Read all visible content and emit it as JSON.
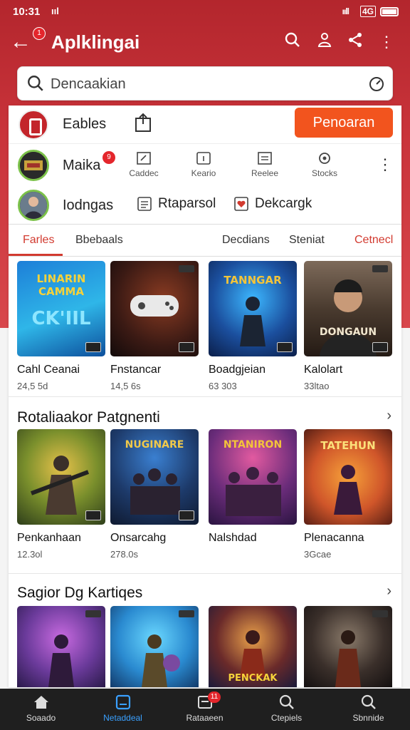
{
  "status_bar": {
    "time": "10:31",
    "left_signal": "ııl",
    "right_signal": "ııll",
    "network": "4G"
  },
  "app_bar": {
    "title": "Aplklingai",
    "back_badge": "1"
  },
  "search": {
    "placeholder": "Dencaakian"
  },
  "top_row": {
    "label": "Eables",
    "button": "Penoaran"
  },
  "profiles": [
    {
      "name": "Maika",
      "badge": "9",
      "actions": [
        "Caddec",
        "Keario",
        "Reelee",
        "Stocks"
      ]
    },
    {
      "name": "Iodngas",
      "chips": [
        "Rtaparsol",
        "Dekcargk"
      ]
    }
  ],
  "tabs": [
    "Farles",
    "Bbebaals",
    "Decdians",
    "Steniat",
    "Cetnecl"
  ],
  "sections": [
    {
      "title": "",
      "tiles": [
        {
          "name": "Cahl Ceanai",
          "meta": "24,5 5d",
          "art_text": "LINARIN\nCAMMA",
          "art_text2": "CK'IIL"
        },
        {
          "name": "Fnstancar",
          "meta": "14,5 6s",
          "art_text": "",
          "art_text2": ""
        },
        {
          "name": "Boadgjeian",
          "meta": "63 303",
          "art_text": "TANNGAR",
          "art_text2": ""
        },
        {
          "name": "Kalolart",
          "meta": "33ltao",
          "art_text": "",
          "art_text2": "DONGAUN"
        }
      ]
    },
    {
      "title": "Rotaliaakor Patgnenti",
      "tiles": [
        {
          "name": "Penkanhaan",
          "meta": "12.3ol",
          "art_text": "",
          "art_text2": ""
        },
        {
          "name": "Onsarcahg",
          "meta": "278.0s",
          "art_text": "NUGINARE",
          "art_text2": ""
        },
        {
          "name": "Nalshdad",
          "meta": "",
          "art_text": "NTANIRON",
          "art_text2": ""
        },
        {
          "name": "Plenacanna",
          "meta": "3Gcae",
          "art_text": "TATEHUN",
          "art_text2": ""
        }
      ]
    },
    {
      "title": "Sagior Dg Kartiqes",
      "tiles": [
        {
          "name": "",
          "meta": "",
          "art_text": "",
          "art_text2": ""
        },
        {
          "name": "",
          "meta": "",
          "art_text": "",
          "art_text2": ""
        },
        {
          "name": "",
          "meta": "",
          "art_text": "",
          "art_text2": "PENCKAK"
        },
        {
          "name": "",
          "meta": "",
          "art_text": "",
          "art_text2": ""
        }
      ]
    }
  ],
  "bottom_nav": [
    {
      "label": "Soaado"
    },
    {
      "label": "Netaddeal"
    },
    {
      "label": "Rataaeen",
      "badge": "11"
    },
    {
      "label": "Ctepiels"
    },
    {
      "label": "Sbnnide"
    }
  ],
  "colors": {
    "brand": "#c9333a",
    "accent": "#f2541e",
    "nav_active": "#3aa0ff",
    "tab_active": "#d23a2f"
  }
}
